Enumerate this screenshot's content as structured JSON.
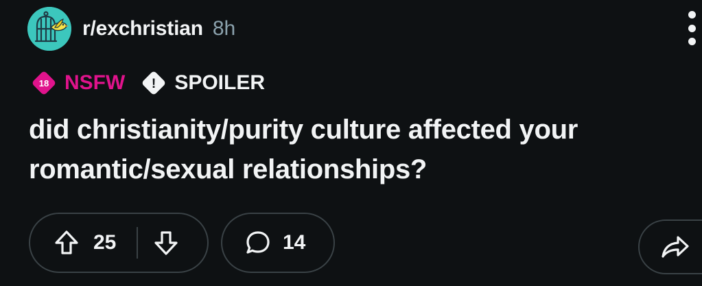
{
  "post": {
    "subreddit": "r/exchristian",
    "time": "8h",
    "tags": {
      "nsfw_badge": "18",
      "nsfw_label": "NSFW",
      "spoiler_badge": "!",
      "spoiler_label": "SPOILER"
    },
    "title": "did christianity/purity culture affected your romantic/sexual relationships?",
    "votes": "25",
    "comments": "14"
  },
  "colors": {
    "background": "#0e1113",
    "text": "#f2f4f5",
    "muted": "#8ba2ad",
    "nsfw": "#e0138c",
    "avatar": "#3cc7bd",
    "border": "#3a4246"
  },
  "icons": {
    "avatar": "birdcage-bird-icon",
    "menu": "more-vertical-icon",
    "upvote": "arrow-up-icon",
    "downvote": "arrow-down-icon",
    "comment": "speech-bubble-icon",
    "share": "share-arrow-icon"
  }
}
